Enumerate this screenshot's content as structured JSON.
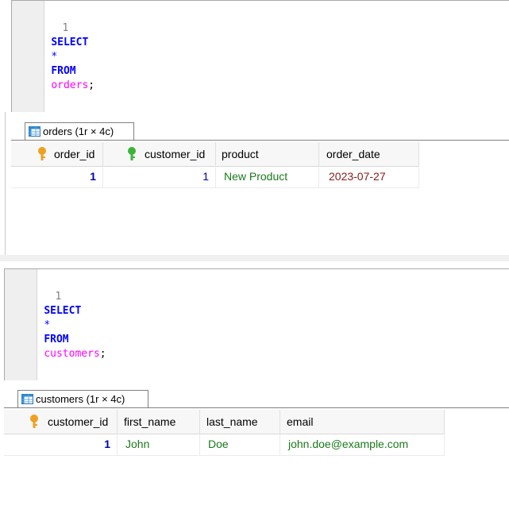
{
  "panel1": {
    "query": {
      "line_no": "1",
      "kw_select": "SELECT",
      "star": "*",
      "kw_from": "FROM",
      "table": "orders",
      "semicolon": ";"
    },
    "tab_label": "orders (1r × 4c)",
    "columns": [
      "order_id",
      "customer_id",
      "product",
      "order_date"
    ],
    "row": {
      "order_id": "1",
      "customer_id": "1",
      "product": "New Product",
      "order_date": "2023-07-27"
    }
  },
  "panel2": {
    "query": {
      "line_no": "1",
      "kw_select": "SELECT",
      "star": "*",
      "kw_from": "FROM",
      "table": "customers",
      "semicolon": ";"
    },
    "tab_label": "customers (1r × 4c)",
    "columns": [
      "customer_id",
      "first_name",
      "last_name",
      "email"
    ],
    "row": {
      "customer_id": "1",
      "first_name": "John",
      "last_name": "Doe",
      "email": "john.doe@example.com"
    }
  },
  "colors": {
    "keyword": "#0000ff",
    "table_name": "#ff00ff",
    "string": "#1b7a1b",
    "date": "#8b1a1a",
    "number": "#0000b0",
    "primary_key": "#f0a020",
    "foreign_key": "#3cb43c"
  }
}
